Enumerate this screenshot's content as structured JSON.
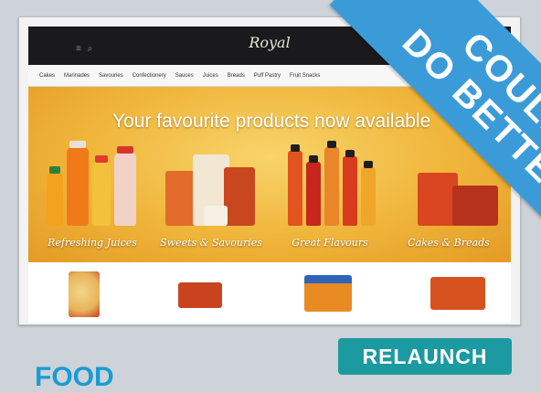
{
  "site": {
    "logo": "Royal",
    "menu_icon": "≡ ⌕"
  },
  "nav": {
    "items": [
      "Cakes",
      "Marinades",
      "Savouries",
      "Confectionery",
      "Sauces",
      "Juices",
      "Breads",
      "Puff Pastry",
      "Fruit Snacks"
    ]
  },
  "banner": {
    "headline": "Your favourite products now available",
    "categories": [
      "Refreshing Juices",
      "Sweets & Savouries",
      "Great Flavours",
      "Cakes & Breads"
    ]
  },
  "ribbon": {
    "line1": "COULD",
    "line2": "DO BETTER"
  },
  "relaunch_label": "RELAUNCH",
  "section_label": "FOOD",
  "colors": {
    "ribbon": "#3b9bd9",
    "relaunch": "#1c9aa1",
    "section": "#1a9bd3",
    "banner": "#f0b53a"
  }
}
